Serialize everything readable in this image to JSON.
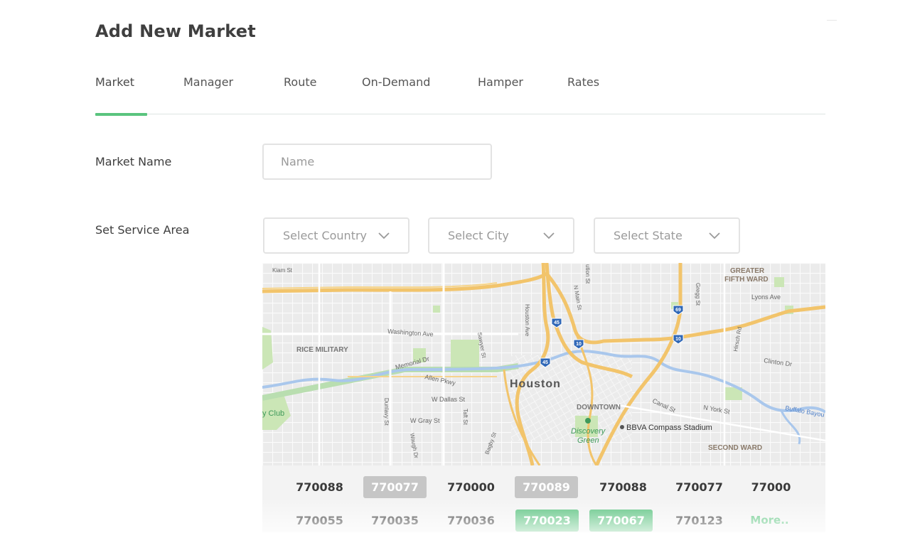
{
  "page": {
    "title": "Add New Market"
  },
  "tabs": [
    {
      "label": "Market",
      "active": true
    },
    {
      "label": "Manager",
      "active": false
    },
    {
      "label": "Route",
      "active": false
    },
    {
      "label": "On-Demand",
      "active": false
    },
    {
      "label": "Hamper",
      "active": false
    },
    {
      "label": "Rates",
      "active": false
    }
  ],
  "colors": {
    "accent": "#5ac47e",
    "chip_grey": "#c6c6c6",
    "chip_green": "#54c07a",
    "border": "#e3e3e3"
  },
  "form": {
    "market_name": {
      "label": "Market Name",
      "placeholder": "Name",
      "value": ""
    },
    "service_area": {
      "label": "Set Service Area",
      "country": {
        "placeholder": "Select Country",
        "icon": "chevron-down-icon"
      },
      "city": {
        "placeholder": "Select City",
        "icon": "chevron-down-icon"
      },
      "state": {
        "placeholder": "Select State",
        "icon": "chevron-down-icon"
      }
    }
  },
  "map": {
    "labels": {
      "houston": "Houston",
      "rice_military": "RICE MILITARY",
      "downtown": "DOWNTOWN",
      "greater_fifth_ward_1": "GREATER",
      "greater_fifth_ward_2": "FIFTH WARD",
      "second_ward": "SECOND WARD",
      "stadium": "BBVA Compass Stadium",
      "discovery_1": "Discovery",
      "discovery_2": "Green",
      "club": "y Club",
      "washington": "Washington Ave",
      "memorial": "Memorial Dr",
      "allen": "Allen Pkwy",
      "w_dallas": "W Dallas St",
      "w_gray": "W Gray St",
      "lyons": "Lyons Ave",
      "clinton": "Clinton Dr",
      "canal": "Canal St",
      "n_york": "N York St",
      "buffalo": "Buffalo Bayou",
      "kiam": "Kiam St",
      "houston_ave": "Houston Ave",
      "n_main": "N Main St",
      "gregg": "Gregg St",
      "hirsch": "Hirsch Rd",
      "sawyer": "Sawyer St",
      "taft": "Taft St",
      "bagby": "Bagby St",
      "dunlavy": "Dunlavy St",
      "waugh": "Waugh Dr",
      "elysian": "ution St",
      "shield_45a": "45",
      "shield_45b": "45",
      "shield_10a": "10",
      "shield_10b": "10",
      "shield_69": "69"
    }
  },
  "zip_codes": {
    "row1": [
      {
        "code": "770088",
        "state": "plain"
      },
      {
        "code": "770077",
        "state": "grey"
      },
      {
        "code": "770000",
        "state": "plain"
      },
      {
        "code": "770089",
        "state": "grey"
      },
      {
        "code": "770088",
        "state": "plain"
      },
      {
        "code": "770077",
        "state": "plain"
      },
      {
        "code": "77000",
        "state": "plain"
      }
    ],
    "row2": [
      {
        "code": "770055",
        "state": "plain"
      },
      {
        "code": "770035",
        "state": "plain"
      },
      {
        "code": "770036",
        "state": "plain"
      },
      {
        "code": "770023",
        "state": "green"
      },
      {
        "code": "770067",
        "state": "green"
      },
      {
        "code": "770123",
        "state": "plain"
      }
    ],
    "more_label": "More.."
  }
}
